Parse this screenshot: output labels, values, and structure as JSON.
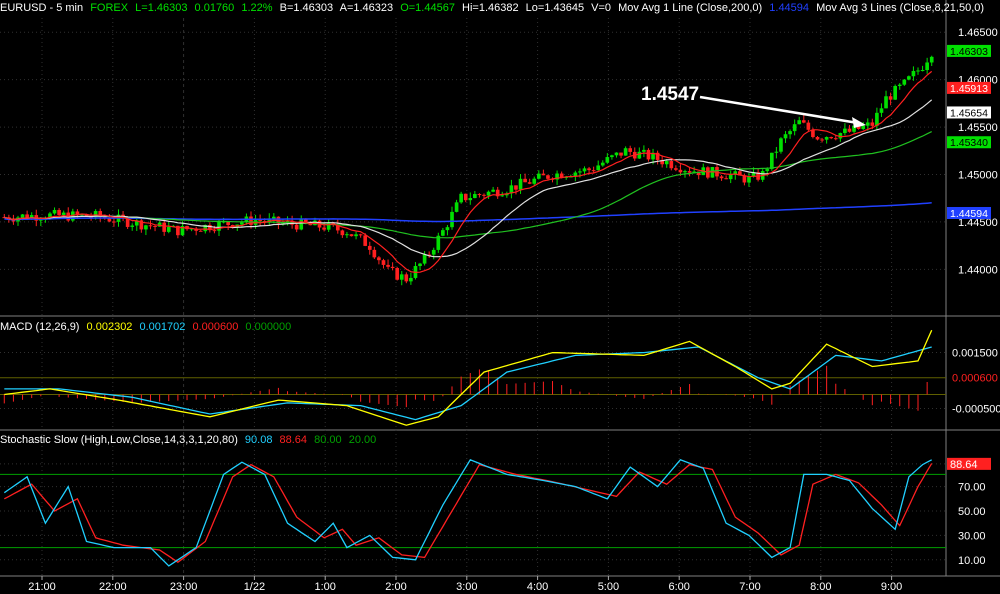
{
  "header": {
    "symbol": "EURUSD - 5 min",
    "market": "FOREX",
    "last": "L=1.46303",
    "change": "0.01760",
    "change_pct": "1.22%",
    "bid": "B=1.46303",
    "ask": "A=1.46323",
    "open": "O=1.44567",
    "high": "Hi=1.46382",
    "low": "Lo=1.43645",
    "volume": "V=0",
    "ma1_label": "Mov Avg 1 Line (Close,200,0)",
    "ma1_value": "1.44594",
    "ma3_label": "Mov Avg 3 Lines (Close,8,21,50,0)"
  },
  "macd_header": {
    "label": "MACD (12,26,9)",
    "v1": "0.002302",
    "v2": "0.001702",
    "v3": "0.000600",
    "v4": "0.000000"
  },
  "stoch_header": {
    "label": "Stochastic Slow (High,Low,Close,14,3,3,1,20,80)",
    "v1": "90.08",
    "v2": "88.64",
    "v3": "80.00",
    "v4": "20.00"
  },
  "annotation": {
    "text": "1.4547"
  },
  "colors": {
    "up": "#00e000",
    "down": "#ff2020",
    "ma_fast": "#ff2020",
    "ma_mid": "#e0e0e0",
    "ma_slow": "#20c020",
    "ma200": "#2040ff",
    "macd": "#ffff00",
    "signal": "#20d0ff",
    "grid": "#303030",
    "stoch_k": "#20d0ff",
    "stoch_d": "#ff2020"
  },
  "chart_data": [
    {
      "type": "candlestick",
      "name": "price",
      "ylim": [
        1.4355,
        1.4665
      ],
      "y_ticks": [
        "1.46500",
        "1.46000",
        "1.45500",
        "1.45000",
        "1.44500",
        "1.44000"
      ],
      "y_tick_values": [
        1.465,
        1.46,
        1.455,
        1.45,
        1.445,
        1.44
      ],
      "x_ticks": [
        "21:00",
        "22:00",
        "23:00",
        "1/22",
        "1:00",
        "2:00",
        "3:00",
        "4:00",
        "5:00",
        "6:00",
        "7:00",
        "8:00",
        "9:00"
      ],
      "price_labels": [
        {
          "text": "1.46303",
          "value": 1.46303,
          "color": "#00e000"
        },
        {
          "text": "1.45913",
          "value": 1.45913,
          "color": "#ff2020"
        },
        {
          "text": "1.45654",
          "value": 1.45654,
          "color": "#ffffff"
        },
        {
          "text": "1.45340",
          "value": 1.4534,
          "color": "#00e000"
        },
        {
          "text": "1.44594",
          "value": 1.44594,
          "color": "#2040ff"
        }
      ],
      "anchors": [
        [
          0,
          1.4455
        ],
        [
          8,
          1.4457
        ],
        [
          20,
          1.4456
        ],
        [
          30,
          1.4448
        ],
        [
          38,
          1.4441
        ],
        [
          45,
          1.4446
        ],
        [
          55,
          1.4452
        ],
        [
          60,
          1.4449
        ],
        [
          70,
          1.4445
        ],
        [
          75,
          1.444
        ],
        [
          80,
          1.4425
        ],
        [
          84,
          1.4398
        ],
        [
          88,
          1.439
        ],
        [
          92,
          1.441
        ],
        [
          96,
          1.444
        ],
        [
          100,
          1.4475
        ],
        [
          110,
          1.4485
        ],
        [
          120,
          1.45
        ],
        [
          128,
          1.4505
        ],
        [
          136,
          1.4525
        ],
        [
          142,
          1.4518
        ],
        [
          150,
          1.4505
        ],
        [
          158,
          1.45
        ],
        [
          163,
          1.4495
        ],
        [
          166,
          1.45
        ],
        [
          170,
          1.4535
        ],
        [
          174,
          1.4555
        ],
        [
          178,
          1.454
        ],
        [
          185,
          1.4545
        ],
        [
          190,
          1.4553
        ],
        [
          193,
          1.458
        ],
        [
          197,
          1.4595
        ],
        [
          201,
          1.4615
        ],
        [
          203,
          1.463
        ]
      ],
      "bar_count": 204
    },
    {
      "type": "line",
      "name": "macd",
      "ylim": [
        -0.0012,
        0.0022
      ],
      "y_ticks": [
        "0.001500",
        "0.000600",
        "-0.000500"
      ],
      "y_tick_values": [
        0.0015,
        0.0006,
        -0.0005
      ],
      "macd_anchors": [
        [
          0,
          0.0
        ],
        [
          10,
          0.0002
        ],
        [
          25,
          -0.0002
        ],
        [
          45,
          -0.0008
        ],
        [
          60,
          -0.0002
        ],
        [
          75,
          -0.0004
        ],
        [
          88,
          -0.0011
        ],
        [
          95,
          -0.0008
        ],
        [
          105,
          0.0008
        ],
        [
          120,
          0.0015
        ],
        [
          140,
          0.0014
        ],
        [
          150,
          0.0019
        ],
        [
          160,
          0.001
        ],
        [
          168,
          0.0002
        ],
        [
          172,
          0.0004
        ],
        [
          180,
          0.0018
        ],
        [
          190,
          0.001
        ],
        [
          200,
          0.0012
        ],
        [
          203,
          0.0023
        ]
      ],
      "signal_anchors": [
        [
          0,
          0.0002
        ],
        [
          12,
          0.0002
        ],
        [
          28,
          -0.0001
        ],
        [
          45,
          -0.0007
        ],
        [
          62,
          -0.0003
        ],
        [
          78,
          -0.0004
        ],
        [
          90,
          -0.0009
        ],
        [
          100,
          -0.0004
        ],
        [
          110,
          0.0008
        ],
        [
          125,
          0.0014
        ],
        [
          140,
          0.0015
        ],
        [
          152,
          0.0017
        ],
        [
          165,
          0.0006
        ],
        [
          172,
          0.0002
        ],
        [
          182,
          0.0014
        ],
        [
          192,
          0.0012
        ],
        [
          203,
          0.0017
        ]
      ],
      "histogram_value": 0.0006
    },
    {
      "type": "line",
      "name": "stochastic",
      "ylim": [
        0,
        100
      ],
      "y_ticks": [
        "88.64",
        "70.00",
        "50.00",
        "30.00",
        "10.00"
      ],
      "y_tick_values": [
        88.64,
        70,
        50,
        30,
        10
      ],
      "k_anchors": [
        [
          0,
          65
        ],
        [
          5,
          78
        ],
        [
          9,
          40
        ],
        [
          14,
          70
        ],
        [
          18,
          25
        ],
        [
          24,
          20
        ],
        [
          32,
          20
        ],
        [
          36,
          5
        ],
        [
          42,
          20
        ],
        [
          48,
          80
        ],
        [
          52,
          90
        ],
        [
          57,
          80
        ],
        [
          62,
          40
        ],
        [
          68,
          25
        ],
        [
          72,
          40
        ],
        [
          75,
          20
        ],
        [
          80,
          30
        ],
        [
          85,
          12
        ],
        [
          90,
          10
        ],
        [
          96,
          55
        ],
        [
          102,
          92
        ],
        [
          110,
          80
        ],
        [
          118,
          75
        ],
        [
          125,
          70
        ],
        [
          132,
          60
        ],
        [
          137,
          86
        ],
        [
          143,
          70
        ],
        [
          148,
          92
        ],
        [
          153,
          85
        ],
        [
          158,
          40
        ],
        [
          163,
          30
        ],
        [
          168,
          12
        ],
        [
          172,
          20
        ],
        [
          175,
          80
        ],
        [
          180,
          80
        ],
        [
          185,
          75
        ],
        [
          190,
          52
        ],
        [
          195,
          35
        ],
        [
          198,
          78
        ],
        [
          201,
          88
        ],
        [
          203,
          92
        ]
      ],
      "d_anchors": [
        [
          0,
          60
        ],
        [
          6,
          72
        ],
        [
          11,
          50
        ],
        [
          16,
          60
        ],
        [
          20,
          28
        ],
        [
          26,
          22
        ],
        [
          34,
          18
        ],
        [
          38,
          8
        ],
        [
          44,
          25
        ],
        [
          50,
          78
        ],
        [
          54,
          88
        ],
        [
          59,
          78
        ],
        [
          64,
          45
        ],
        [
          70,
          28
        ],
        [
          74,
          35
        ],
        [
          77,
          22
        ],
        [
          82,
          28
        ],
        [
          87,
          14
        ],
        [
          92,
          12
        ],
        [
          98,
          50
        ],
        [
          104,
          88
        ],
        [
          112,
          80
        ],
        [
          120,
          74
        ],
        [
          127,
          68
        ],
        [
          134,
          62
        ],
        [
          139,
          82
        ],
        [
          145,
          72
        ],
        [
          150,
          88
        ],
        [
          155,
          84
        ],
        [
          160,
          45
        ],
        [
          165,
          32
        ],
        [
          170,
          14
        ],
        [
          174,
          22
        ],
        [
          177,
          72
        ],
        [
          182,
          80
        ],
        [
          187,
          73
        ],
        [
          192,
          55
        ],
        [
          196,
          38
        ],
        [
          200,
          70
        ],
        [
          203,
          89
        ]
      ],
      "levels": [
        80,
        20
      ]
    }
  ]
}
